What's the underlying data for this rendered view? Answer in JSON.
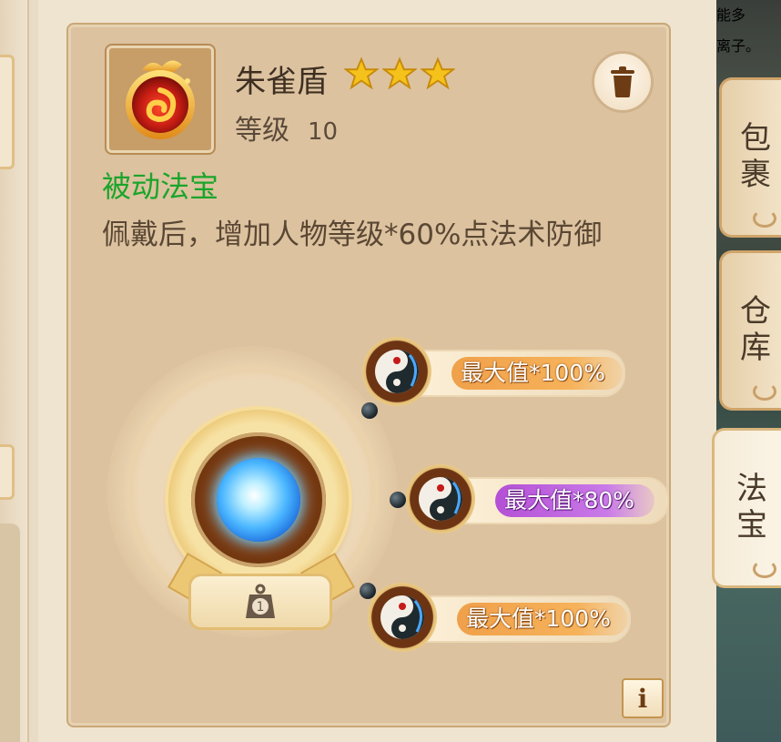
{
  "item": {
    "name": "朱雀盾",
    "stars": 3,
    "level_label": "等级",
    "level_value": "10",
    "type": "被动法宝",
    "description": "佩戴后，增加人物等级*60%点法术防御",
    "icon": "vermilion-bird-shield-icon"
  },
  "slot": {
    "badge_number": "1",
    "orb_icon": "blue-spirit-orb"
  },
  "attributes": [
    {
      "label": "最大值*100%",
      "quality": "orange"
    },
    {
      "label": "最大值*80%",
      "quality": "purple"
    },
    {
      "label": "最大值*100%",
      "quality": "orange"
    }
  ],
  "side_tabs": [
    {
      "label": "包裹",
      "active": false
    },
    {
      "label": "仓库",
      "active": false
    },
    {
      "label": "法宝",
      "active": true
    }
  ],
  "buttons": {
    "discard": "trash-icon",
    "info": "i"
  },
  "background_text": "能多\n离子。",
  "colors": {
    "type_label": "#1aa52a",
    "pill_orange": "#f6b25a",
    "pill_purple": "#c97ae8",
    "star": "#f5c21c"
  }
}
